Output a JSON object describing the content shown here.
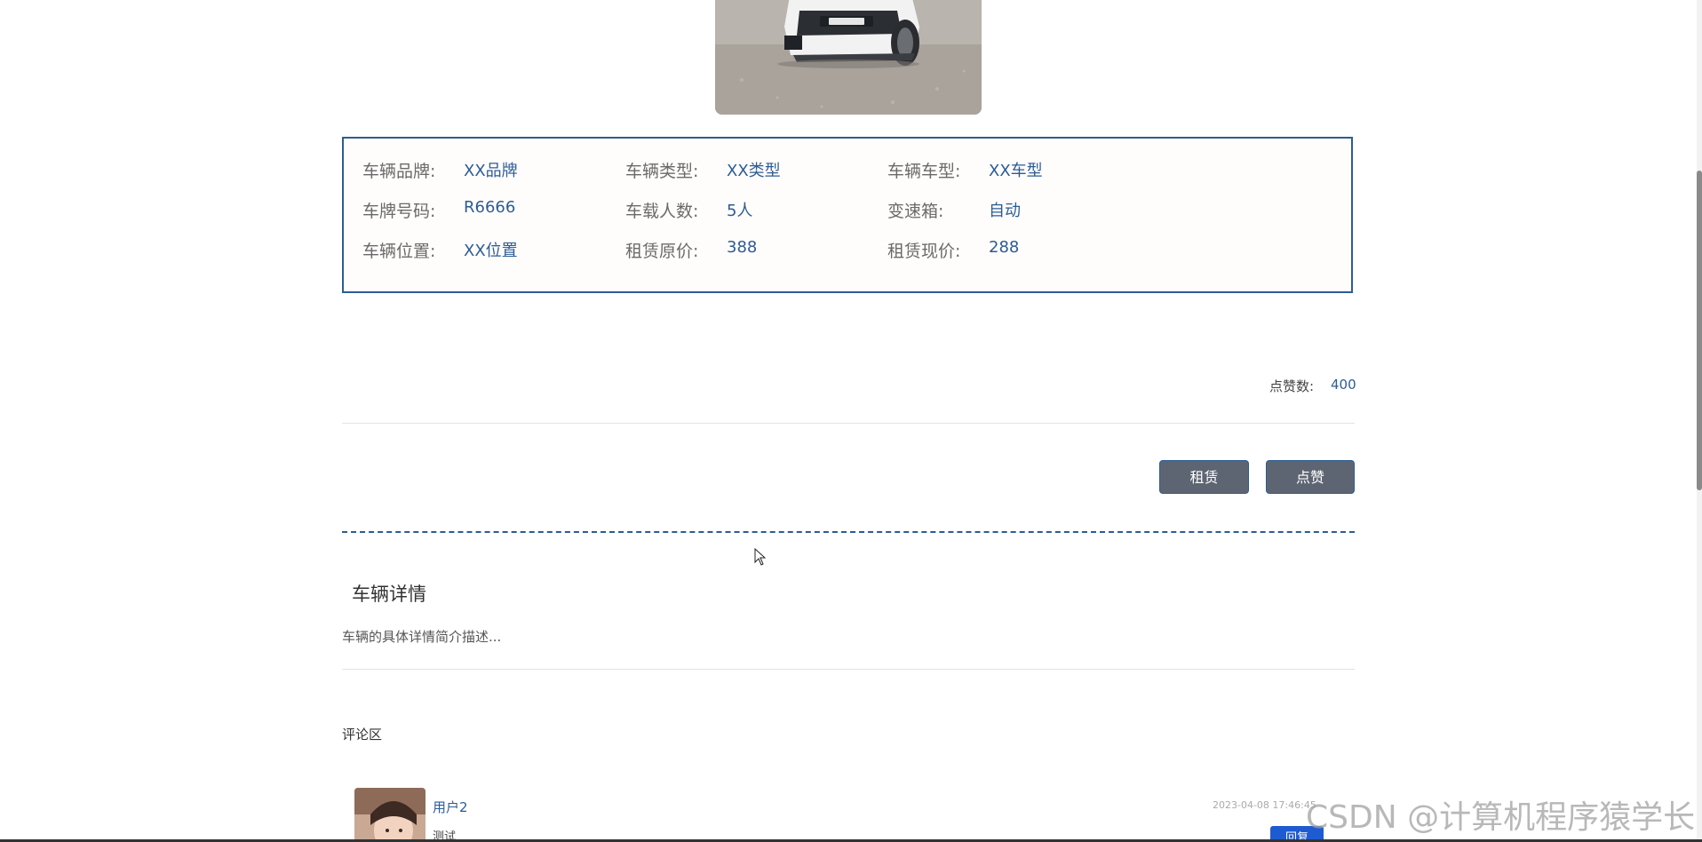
{
  "vehicle_info": {
    "brand_label": "车辆品牌:",
    "brand_value": "XX品牌",
    "type_label": "车辆类型:",
    "type_value": "XX类型",
    "model_label": "车辆车型:",
    "model_value": "XX车型",
    "plate_label": "车牌号码:",
    "plate_value": "R6666",
    "seats_label": "车载人数:",
    "seats_value": "5人",
    "gearbox_label": "变速箱:",
    "gearbox_value": "自动",
    "location_label": "车辆位置:",
    "location_value": "XX位置",
    "original_price_label": "租赁原价:",
    "original_price_value": "388",
    "current_price_label": "租赁现价:",
    "current_price_value": "288"
  },
  "likes": {
    "label": "点赞数:",
    "count": "400"
  },
  "actions": {
    "rent_label": "租赁",
    "like_label": "点赞"
  },
  "details": {
    "title": "车辆详情",
    "description": "车辆的具体详情简介描述..."
  },
  "comments": {
    "title": "评论区",
    "items": [
      {
        "user": "用户2",
        "text": "测试",
        "time": "2023-04-08 17:46:45",
        "reply_label": "回复"
      }
    ]
  },
  "watermark": "CSDN @计算机程序猿学长",
  "colors": {
    "accent": "#2c5c95",
    "button_bg": "#5e6572",
    "reply_button": "#1e5bd1"
  }
}
